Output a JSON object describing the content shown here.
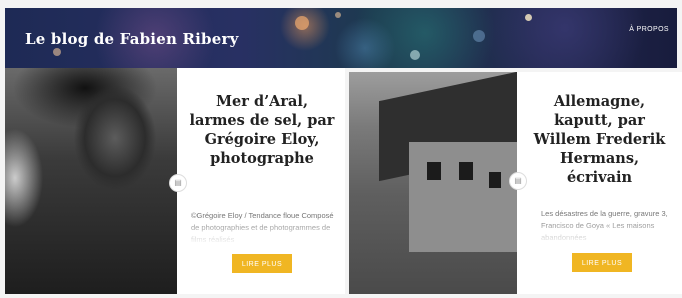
{
  "header": {
    "site_title": "Le blog de Fabien Ribery",
    "nav_link": "À PROPOS"
  },
  "posts": [
    {
      "title": "Mer d’Aral, larmes de sel, par Grégoire Eloy, photographe",
      "excerpt": "©Grégoire Eloy / Tendance floue Composé de photographies et de photogrammes de films réalisés",
      "button": "LIRE PLUS",
      "icon": "document-icon"
    },
    {
      "title": "Allemagne, kaputt, par Willem Frederik Hermans, écrivain",
      "excerpt": "Les désastres de la guerre, gravure 3, Francisco de Goya « Les maisons abandonnées",
      "button": "LIRE PLUS",
      "icon": "document-icon"
    }
  ],
  "colors": {
    "accent": "#f0b623",
    "header_bg": "#1e2a55"
  }
}
